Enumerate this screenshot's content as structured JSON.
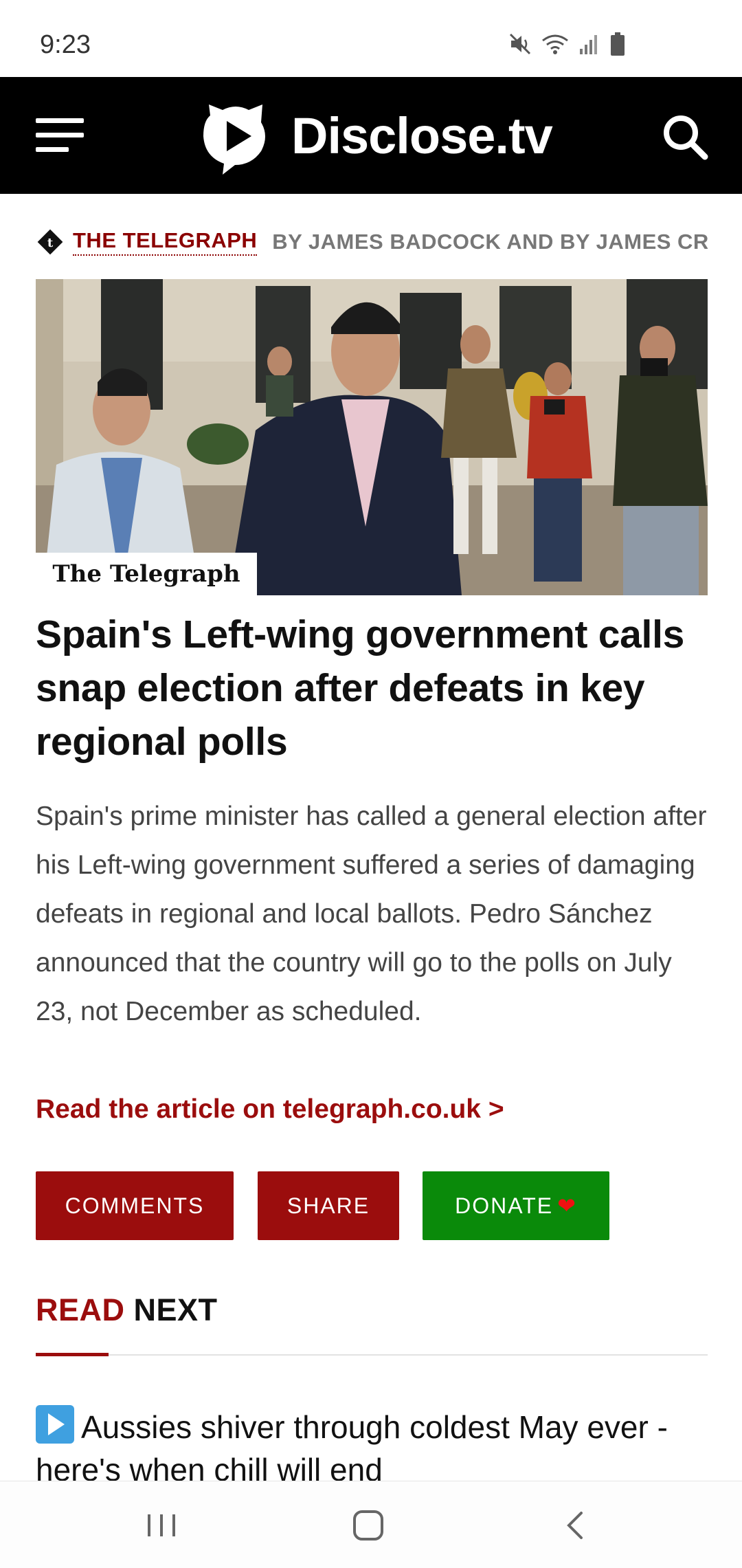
{
  "status_bar": {
    "time": "9:23",
    "icons": [
      "mute-icon",
      "wifi-icon",
      "signal-icon",
      "battery-icon"
    ]
  },
  "header": {
    "logo_text": "Disclose.tv",
    "icons": [
      "menu-icon",
      "logo-play-icon",
      "search-icon"
    ],
    "background": "#000000"
  },
  "article": {
    "source": "THE TELEGRAPH",
    "byline": "BY JAMES BADCOCK AND BY JAMES CRISP",
    "image_badge": "The Telegraph",
    "headline": "Spain's Left-wing government calls snap election after defeats in key regional polls",
    "summary": "Spain's prime minister has called a general election after his Left-wing government suffered a series of damaging defeats in regional and local ballots. Pedro Sánchez announced that the country will go to the polls on July 23, not December as scheduled.",
    "read_link": "Read the article on telegraph.co.uk >"
  },
  "actions": {
    "comments": "COMMENTS",
    "share": "SHARE",
    "donate": "DONATE",
    "donate_emoji": "❤"
  },
  "read_next": {
    "label_red": "READ",
    "label_black": "NEXT",
    "items": [
      {
        "title": "Aussies shiver through coldest May ever - here's when chill will end"
      }
    ]
  },
  "nav_bar": {
    "buttons": [
      "recent-apps-icon",
      "home-icon",
      "back-icon"
    ]
  },
  "colors": {
    "brand_red": "#9b0d0d",
    "donate_green": "#0a8a0a",
    "header_black": "#000000"
  }
}
